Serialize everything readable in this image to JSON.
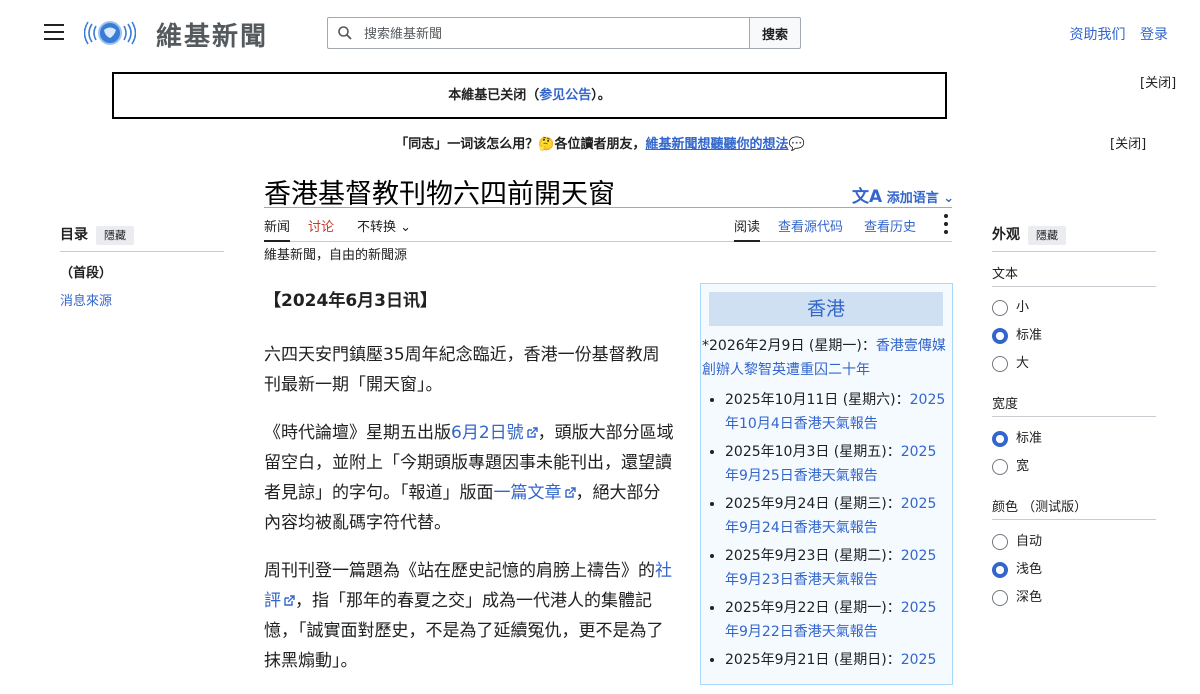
{
  "header": {
    "logo_text": "維基新聞",
    "search_placeholder": "搜索維基新聞",
    "search_button": "搜索",
    "donate": "资助我们",
    "login": "登录"
  },
  "notices": {
    "closed_prefix": "本維基已关闭（",
    "closed_link": "参见公告",
    "closed_suffix": "）。",
    "close1": "[关闭]",
    "survey_prefix": "「同志」一词该怎么用？🤔各位讀者朋友，",
    "survey_link": "維基新聞想聽聽你的想法",
    "survey_suffix": "💬",
    "close2": "[关闭]"
  },
  "page": {
    "title": "香港基督教刊物六四前開天窗",
    "add_language": "添加语言",
    "tabs": {
      "article": "新闻",
      "talk": "讨论",
      "variant": "不转换",
      "read": "阅读",
      "view_source": "查看源代码",
      "history": "查看历史"
    },
    "tagline": "維基新聞，自由的新聞源"
  },
  "toc": {
    "heading": "目录",
    "hide": "隱藏",
    "items": [
      "（首段）",
      "消息來源"
    ]
  },
  "article": {
    "dateline": "【2024年6月3日讯】",
    "p1": "六四天安門鎮壓35周年紀念臨近，香港一份基督教周刊最新一期「開天窗」。",
    "p2_a": "《時代論壇》星期五出版",
    "p2_link1": "6月2日號",
    "p2_b": "，頭版大部分區域留空白，並附上「今期頭版專題因事未能刊出，還望讀者見諒」的字句。「報道」版面",
    "p2_link2": "一篇文章",
    "p2_c": "，絕大部分內容均被亂碼字符代替。",
    "p3_a": "周刊刊登一篇題為《站在歷史記憶的肩膀上禱告》的",
    "p3_link": "社評",
    "p3_b": "，指「那年的春夏之交」成為一代港人的集體記憶，「誠實面對歷史，不是為了延續冤仇，更不是為了抹黑煽動」。"
  },
  "sidebox": {
    "title": "香港",
    "lead_text": "*2026年2月9日 (星期一)：",
    "lead_link": "香港壹傳媒創辦人黎智英遭重囚二十年",
    "items": [
      {
        "date": "2025年10月11日 (星期六)：",
        "link": "2025年10月4日香港天氣報告"
      },
      {
        "date": "2025年10月3日 (星期五)：",
        "link": "2025年9月25日香港天氣報告"
      },
      {
        "date": "2025年9月24日 (星期三)：",
        "link": "2025年9月24日香港天氣報告"
      },
      {
        "date": "2025年9月23日 (星期二)：",
        "link": "2025年9月23日香港天氣報告"
      },
      {
        "date": "2025年9月22日 (星期一)：",
        "link": "2025年9月22日香港天氣報告"
      },
      {
        "date": "2025年9月21日 (星期日)：",
        "link": "2025"
      }
    ]
  },
  "appearance": {
    "heading": "外观",
    "hide": "隱藏",
    "text_label": "文本",
    "text_options": [
      "小",
      "标准",
      "大"
    ],
    "width_label": "宽度",
    "width_options": [
      "标准",
      "宽"
    ],
    "color_label": "颜色 （测试版）",
    "color_options": [
      "自动",
      "浅色",
      "深色"
    ]
  },
  "colors": {
    "link": "#3366cc",
    "talk_red": "#bf3c2c",
    "sidebox_bg": "#f5faff",
    "sidebox_title_bg": "#cee0f2"
  }
}
